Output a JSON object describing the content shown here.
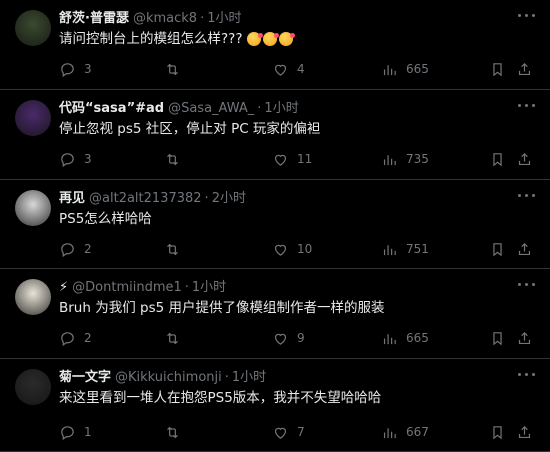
{
  "tweets": [
    {
      "name": "舒茨·普雷瑟",
      "handle": "@kmack8",
      "sep": "·",
      "time": "1小时",
      "text": "请问控制台上的模组怎么样???",
      "has_emoji": true,
      "replies": "3",
      "retweets": "",
      "likes": "4",
      "views": "665",
      "avatar_color": "#3a4a2f"
    },
    {
      "name": "代码“sasa”#ad",
      "handle": "@Sasa_AWA_",
      "sep": "·",
      "time": "1小时",
      "text": "停止忽视 ps5 社区，停止对 PC 玩家的偏袒",
      "has_emoji": false,
      "replies": "3",
      "retweets": "",
      "likes": "11",
      "views": "735",
      "avatar_color": "#4a2a6a"
    },
    {
      "name": "再见",
      "handle": "@alt2alt2137382",
      "sep": "·",
      "time": "2小时",
      "text": "PS5怎么样哈哈",
      "has_emoji": false,
      "replies": "2",
      "retweets": "",
      "likes": "10",
      "views": "751",
      "avatar_color": "#d8d8d8"
    },
    {
      "name": "⚡",
      "handle": "@Dontmiindme1",
      "sep": "·",
      "time": "1小时",
      "text": "Bruh 为我们 ps5 用户提供了像模组制作者一样的服装",
      "has_emoji": false,
      "replies": "2",
      "retweets": "",
      "likes": "9",
      "views": "665",
      "avatar_color": "#e9e4d8"
    },
    {
      "name": "菊一文字",
      "handle": "@Kikkuichimonji",
      "sep": "·",
      "time": "1小时",
      "text": "来这里看到一堆人在抱怨PS5版本，我并不失望哈哈哈",
      "has_emoji": false,
      "replies": "1",
      "retweets": "",
      "likes": "7",
      "views": "667",
      "avatar_color": "#2b2b2b"
    }
  ],
  "colors": {
    "background": "#000000",
    "text": "#e7e9ea",
    "muted": "#71767b",
    "border": "#2f3336"
  }
}
